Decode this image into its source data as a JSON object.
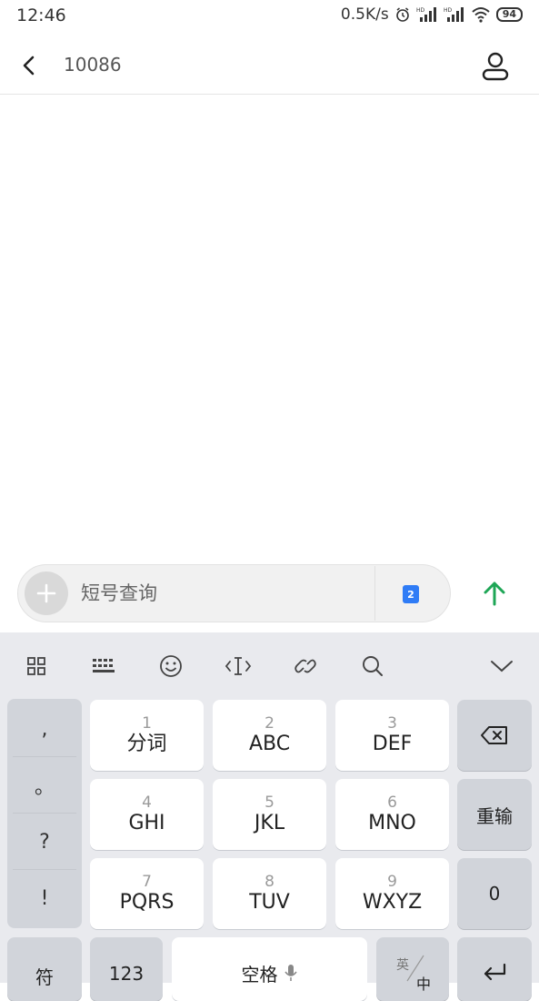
{
  "status_bar": {
    "time": "12:46",
    "network_speed": "0.5K/s",
    "battery": "94",
    "icons": [
      "alarm-icon",
      "signal-hd-icon",
      "signal-hd-icon",
      "wifi-icon",
      "battery-icon"
    ]
  },
  "header": {
    "title": "10086",
    "back_icon": "back-arrow-icon",
    "contact_icon": "contact-icon"
  },
  "composer": {
    "placeholder": "短号查询",
    "sim_badge": "2",
    "send_color": "#1ea656"
  },
  "keyboard": {
    "toolbar_icons": [
      "grid-icon",
      "keyboard-icon",
      "emoji-icon",
      "cursor-icon",
      "link-icon",
      "search-icon",
      "collapse-icon"
    ],
    "punctuation": [
      ",",
      "。",
      "?",
      "!"
    ],
    "keys": [
      {
        "num": "1",
        "label": "分词"
      },
      {
        "num": "2",
        "label": "ABC"
      },
      {
        "num": "3",
        "label": "DEF"
      },
      {
        "num": "4",
        "label": "GHI"
      },
      {
        "num": "5",
        "label": "JKL"
      },
      {
        "num": "6",
        "label": "MNO"
      },
      {
        "num": "7",
        "label": "PQRS"
      },
      {
        "num": "8",
        "label": "TUV"
      },
      {
        "num": "9",
        "label": "WXYZ"
      }
    ],
    "right": {
      "retype": "重输",
      "zero": "0"
    },
    "bottom": {
      "symbol": "符",
      "numbers": "123",
      "space": "空格",
      "lang_top": "英",
      "lang_bottom": "中"
    }
  }
}
